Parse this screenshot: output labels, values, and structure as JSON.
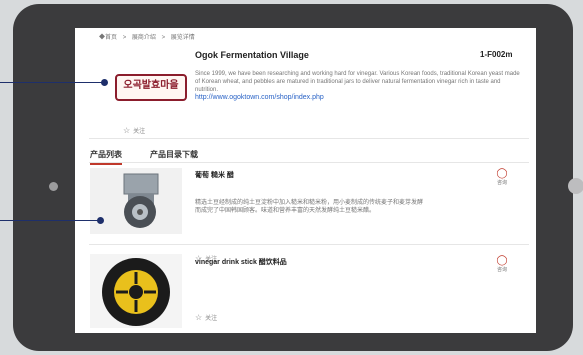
{
  "breadcrumb": [
    "◆首页",
    ">",
    "展商介绍",
    ">",
    "展览详情"
  ],
  "company": {
    "name": "Ogok Fermentation Village",
    "booth": "1-F002m",
    "logo_text": "오곡발효마을",
    "description": "Since 1999, we have been researching and working hard for vinegar. Various Korean foods, traditional Korean yeast made of Korean wheat, and pebbles are matured in traditional jars to deliver natural fermentation vinegar rich in taste and nutrition.",
    "url": "http://www.ogoktown.com/shop/index.php",
    "follow_label": "关注"
  },
  "tabs": [
    {
      "label": "产品列表",
      "active": true
    },
    {
      "label": "产品目录下载",
      "active": false
    }
  ],
  "products": [
    {
      "title": "葡萄 糙米 醋",
      "text": "精选土豆经制成的纯土豆淀粉中加入糙米和糙米粉，用小麦制成的传统麦子和麦芽发酵而成完了中国韩国顾客。味道和营养丰富的天然发酵纯土豆糙米醋。",
      "follow_label": "关注",
      "inquiry_label": "咨询"
    },
    {
      "title": "vinegar drink stick 醋饮料品",
      "text": "",
      "follow_label": "关注",
      "inquiry_label": "咨询"
    }
  ],
  "icons": {
    "star": "☆",
    "chat": "◯"
  }
}
